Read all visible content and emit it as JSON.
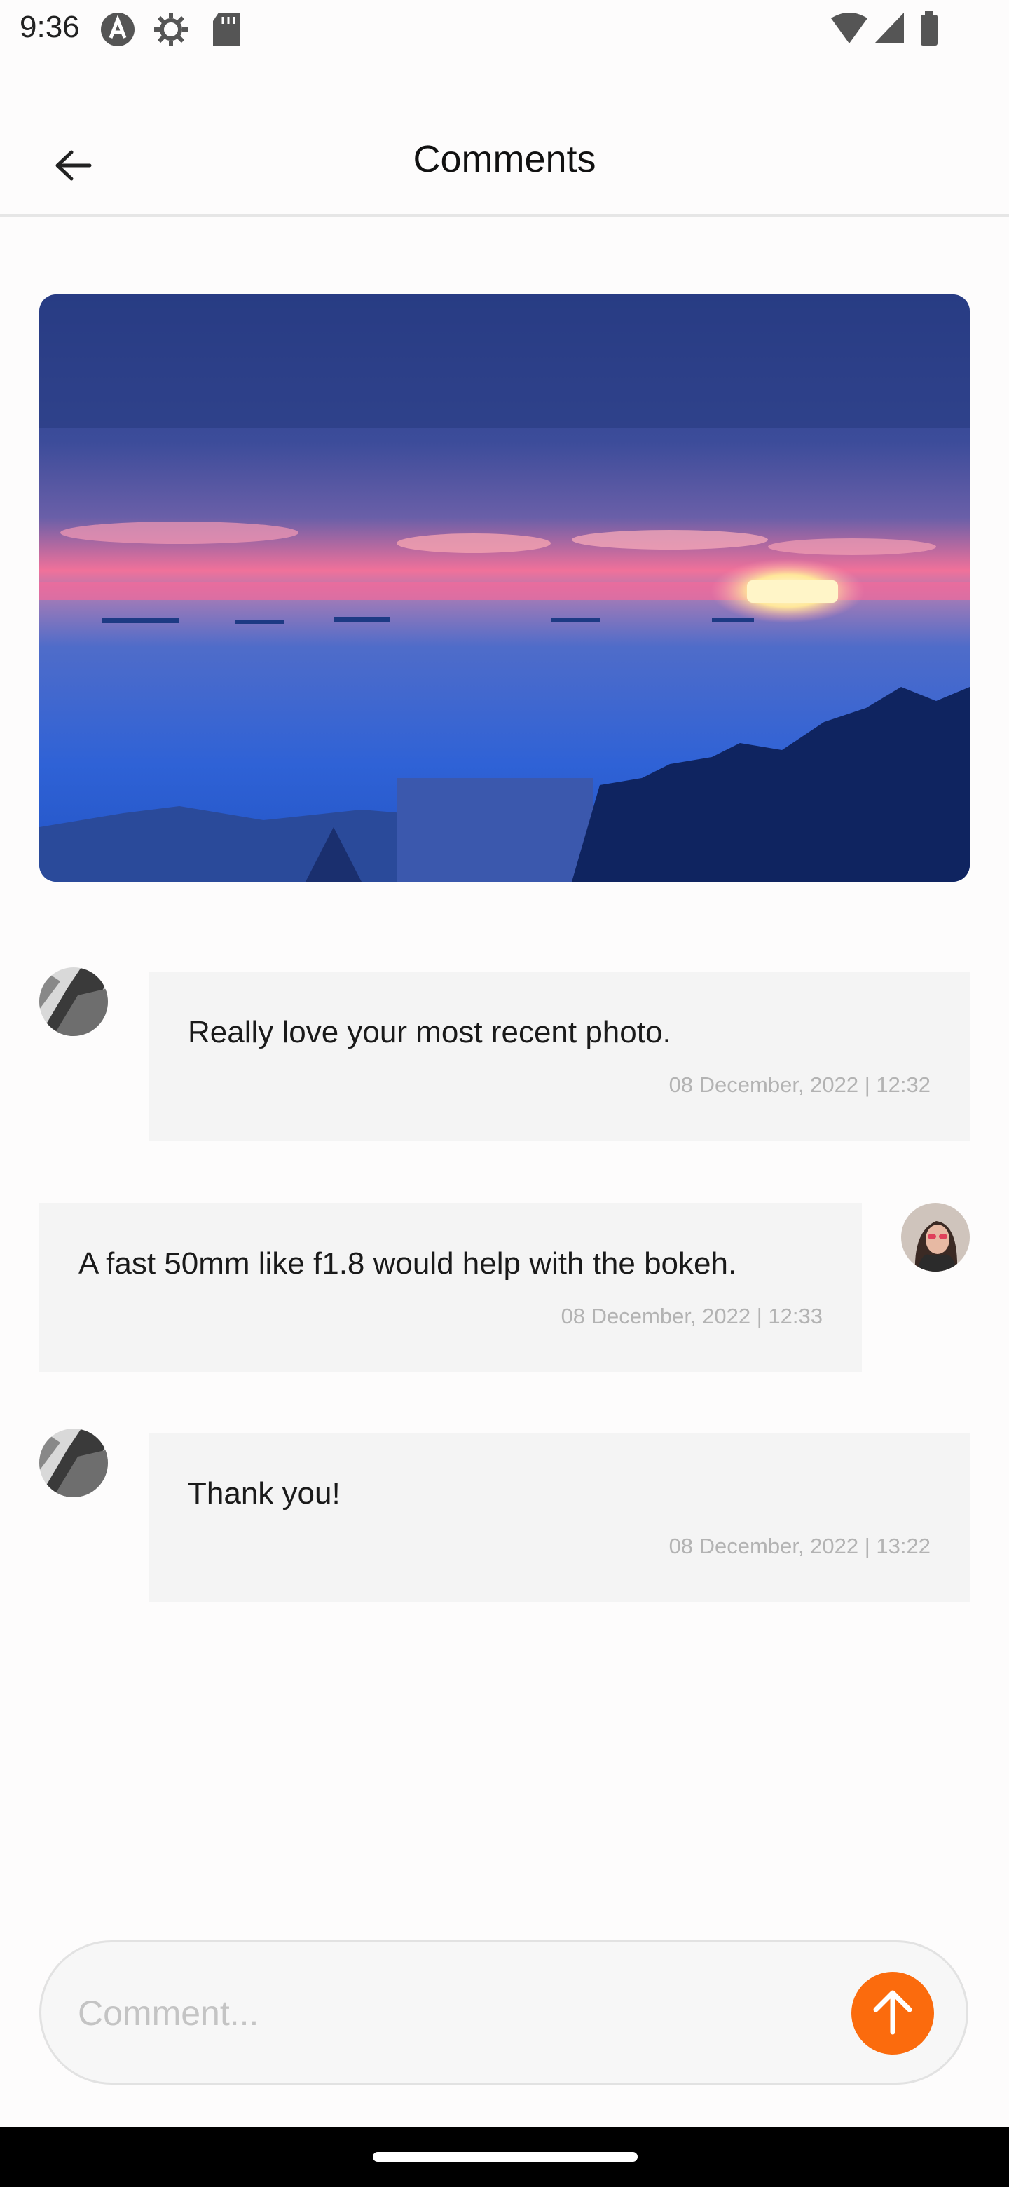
{
  "status_bar": {
    "time": "9:36",
    "left_icons": [
      "app-notification-icon",
      "settings-gear-icon",
      "sd-card-icon"
    ],
    "right_icons": [
      "wifi-icon",
      "cell-signal-icon",
      "battery-icon"
    ]
  },
  "header": {
    "title": "Comments",
    "back_icon": "arrow-left-icon"
  },
  "post": {
    "photo": "sunset-over-sea-photo"
  },
  "comments": [
    {
      "side": "left",
      "avatar": "building-avatar",
      "text": "Really love your most recent photo.",
      "timestamp": "08 December, 2022 | 12:32"
    },
    {
      "side": "right",
      "avatar": "woman-avatar",
      "text": "A fast 50mm like f1.8 would help with the bokeh.",
      "timestamp": "08 December, 2022 | 12:33"
    },
    {
      "side": "left",
      "avatar": "building-avatar",
      "text": "Thank you!",
      "timestamp": "08 December, 2022 | 13:22"
    }
  ],
  "composer": {
    "placeholder": "Comment...",
    "value": "",
    "send_icon": "arrow-up-icon"
  },
  "colors": {
    "accent": "#fb6b0d",
    "bubble_bg": "#f4f4f4",
    "timestamp": "#b3b3b3"
  }
}
